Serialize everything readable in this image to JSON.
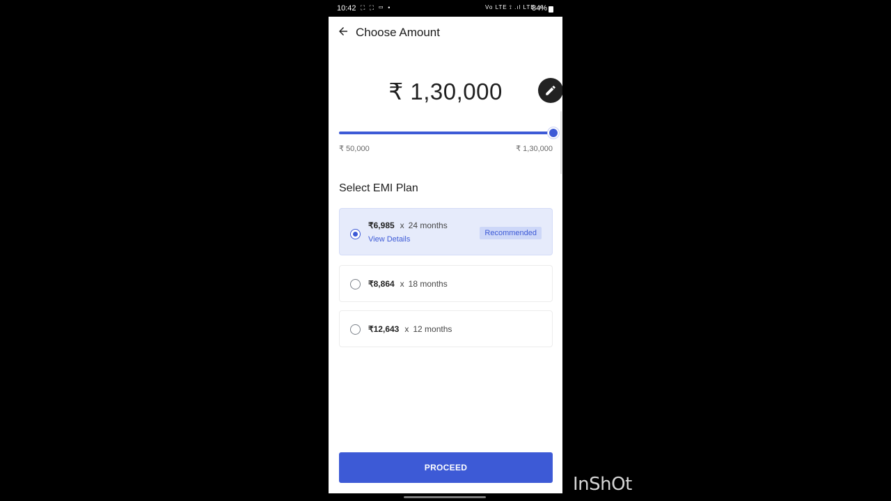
{
  "status_bar": {
    "time": "10:42",
    "left_icons": "⛶ ⛶ ▭ •",
    "right_icons": "Vo LTE ⟟ .ıl LTE .ıl",
    "battery": "84%"
  },
  "header": {
    "title": "Choose Amount"
  },
  "amount": {
    "value": "₹ 1,30,000"
  },
  "slider": {
    "min_label": "₹ 50,000",
    "max_label": "₹ 1,30,000",
    "level": 1.0
  },
  "emi": {
    "section_title": "Select EMI Plan",
    "plans": [
      {
        "amount": "₹6,985",
        "x": "x",
        "months": "24 months",
        "details": "View Details",
        "badge": "Recommended",
        "selected": true
      },
      {
        "amount": "₹8,864",
        "x": "x",
        "months": "18 months",
        "selected": false
      },
      {
        "amount": "₹12,643",
        "x": "x",
        "months": "12 months",
        "selected": false
      }
    ]
  },
  "proceed_label": "PROCEED",
  "watermark": "InShOt",
  "colors": {
    "accent": "#3d5ad6",
    "selected_bg": "#e6ebfb",
    "badge_bg": "#cdd7f8"
  }
}
